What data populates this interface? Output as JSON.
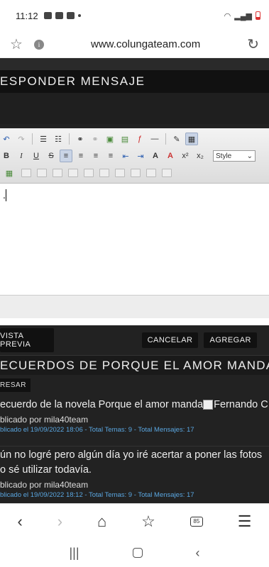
{
  "status": {
    "time": "11:12",
    "icons_left": [
      "image-icon",
      "gmail-icon",
      "cloud-icon",
      "dot"
    ],
    "icons_right": [
      "wifi-icon",
      "signal-icon",
      "battery-low-icon"
    ]
  },
  "browser": {
    "url": "www.colungateam.com",
    "star_icon": "star-icon",
    "info_icon": "info-icon",
    "reload_icon": "reload-icon"
  },
  "respond": {
    "title": "ESPONDER MENSAJE"
  },
  "editor": {
    "style_select": "Style",
    "content_char": "."
  },
  "actions": {
    "preview": "VISTA PREVIA",
    "cancel": "CANCELAR",
    "add": "AGREGAR"
  },
  "topic": {
    "title": "ECUERDOS DE PORQUE EL AMOR MANDA",
    "back_btn": "RESAR"
  },
  "posts": [
    {
      "text": "ecuerdo de la novela Porque el amor manda",
      "broken_img_alt": "Fernando C",
      "by": "blicado por mila40team",
      "meta": "blicado el 19/09/2022 18:06 - Total Temas: 9 - Total Mensajes: 17"
    },
    {
      "text": "ún no logré pero algún día yo iré acertar a poner las fotos",
      "text2": "o sé utilizar todavía.",
      "by": "blicado por mila40team",
      "meta": "blicado el 19/09/2022 18:12 - Total Temas: 9 - Total Mensajes: 17"
    }
  ],
  "bottom_nav": {
    "tabs_count": "85"
  },
  "colors": {
    "page_bg": "#222222",
    "link_meta": "#5aa6e0",
    "accent": "#111111"
  }
}
